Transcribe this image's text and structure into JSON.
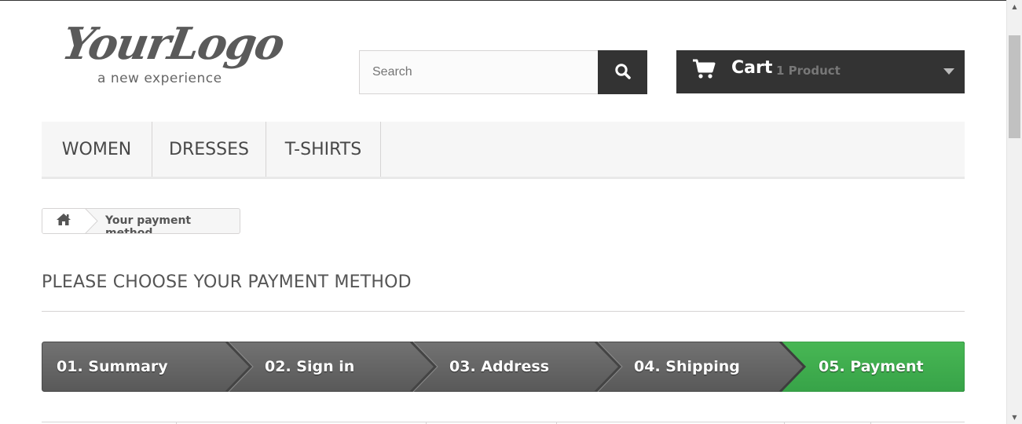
{
  "header": {
    "logo": {
      "main_text": "YourLogo",
      "tagline": "a new experience"
    },
    "search": {
      "placeholder": "Search",
      "button_icon": "search-icon"
    },
    "cart": {
      "label": "Cart",
      "count_text": "1 Product",
      "icon": "shopping-cart-icon"
    }
  },
  "menu": {
    "items": [
      {
        "label": "WOMEN"
      },
      {
        "label": "DRESSES"
      },
      {
        "label": "T-SHIRTS"
      }
    ]
  },
  "breadcrumb": {
    "home_icon": "home-icon",
    "current": "Your payment method"
  },
  "page": {
    "title": "PLEASE CHOOSE YOUR PAYMENT METHOD"
  },
  "steps": [
    {
      "label": "01. Summary",
      "state": "done"
    },
    {
      "label": "02. Sign in",
      "state": "done"
    },
    {
      "label": "03. Address",
      "state": "done"
    },
    {
      "label": "04. Shipping",
      "state": "done"
    },
    {
      "label": "05. Payment",
      "state": "current"
    }
  ],
  "colors": {
    "step_done": "#5d5d5d",
    "step_current": "#3aa94e",
    "dark_bar": "#333333",
    "menu_bg": "#f6f6f6"
  }
}
